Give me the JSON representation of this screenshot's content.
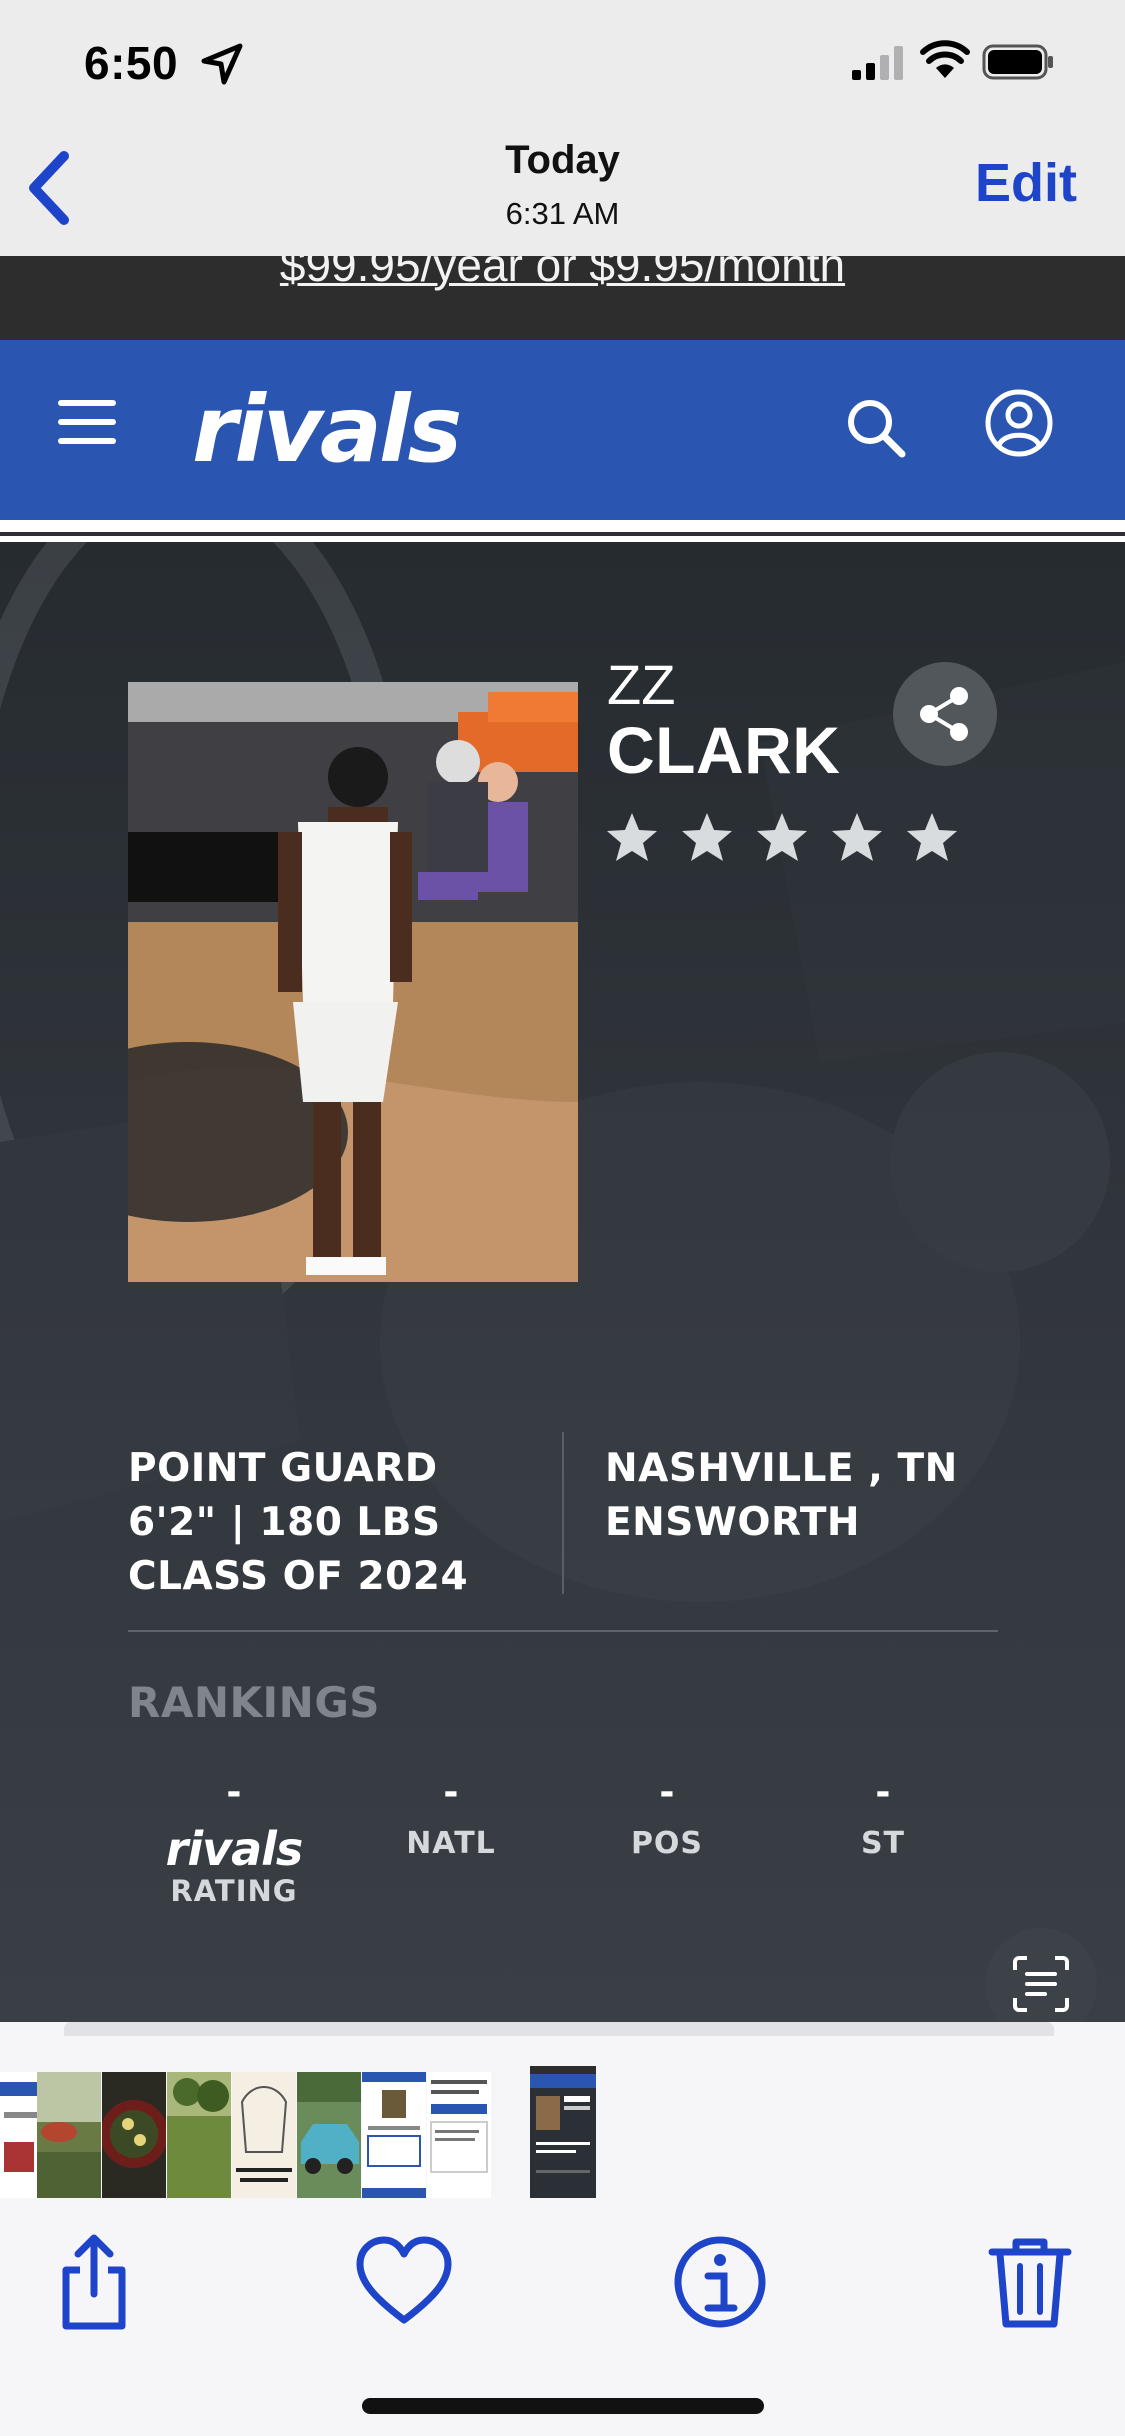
{
  "status_bar": {
    "time": "6:50",
    "icons": [
      "location-arrow-icon",
      "signal-icon",
      "wifi-icon",
      "battery-icon"
    ]
  },
  "nav": {
    "back_icon": "chevron-left-icon",
    "title": "Today",
    "subtitle": "6:31 AM",
    "edit_label": "Edit",
    "accent": "#1d44c9"
  },
  "page": {
    "promo_text": "$99.95/year or $9.95/month",
    "brand": "rivals",
    "brand_color": "#2a56b1",
    "header_icons": [
      "hamburger-menu-icon",
      "search-icon",
      "user-account-icon"
    ],
    "player": {
      "first_name": "ZZ",
      "last_name": "CLARK",
      "stars": 5,
      "stars_filled": 0,
      "position": "POINT GUARD",
      "size": "6'2\" | 180 LBS",
      "class": "CLASS OF 2024",
      "hometown": "NASHVILLE , TN",
      "school": "ENSWORTH"
    },
    "rankings": {
      "title": "RANKINGS",
      "columns": [
        {
          "value": "-",
          "label": "RATING",
          "logo": "rivals"
        },
        {
          "value": "-",
          "label": "NATL"
        },
        {
          "value": "-",
          "label": "POS"
        },
        {
          "value": "-",
          "label": "ST"
        }
      ]
    }
  },
  "toolbar": {
    "icons": [
      "share-icon",
      "heart-icon",
      "info-icon",
      "trash-icon"
    ]
  }
}
